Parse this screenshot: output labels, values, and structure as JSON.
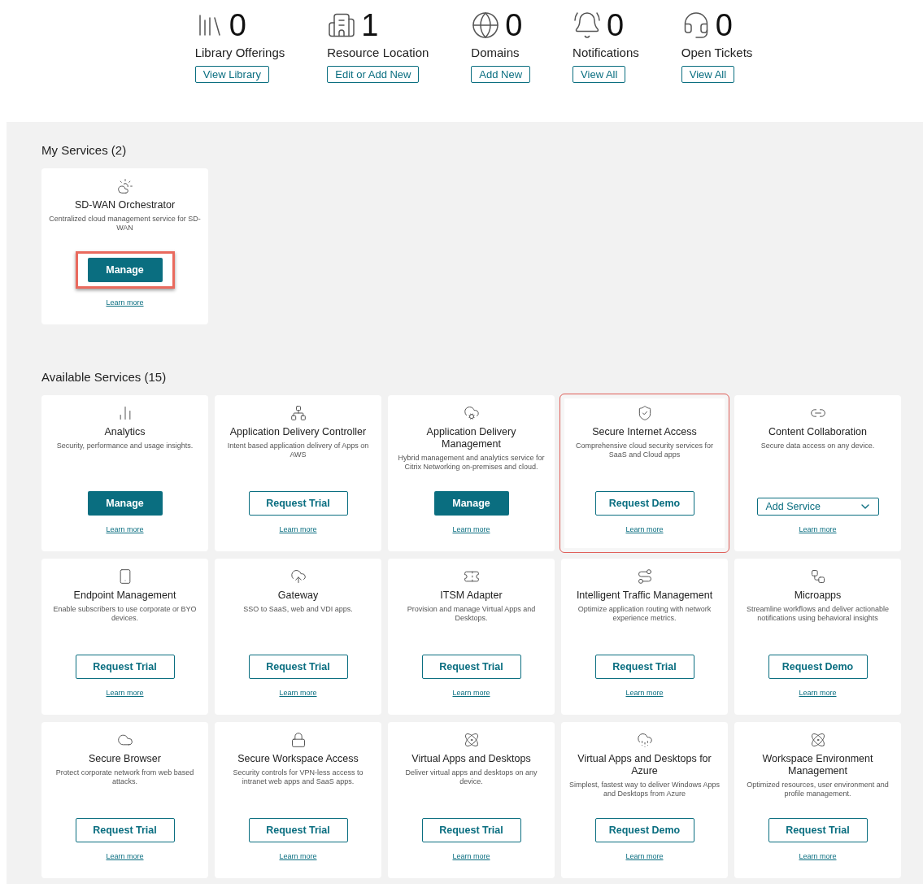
{
  "stats": [
    {
      "count": "0",
      "label": "Library Offerings",
      "action": "View Library"
    },
    {
      "count": "1",
      "label": "Resource Location",
      "action": "Edit or Add New"
    },
    {
      "count": "0",
      "label": "Domains",
      "action": "Add New"
    },
    {
      "count": "0",
      "label": "Notifications",
      "action": "View All"
    },
    {
      "count": "0",
      "label": "Open Tickets",
      "action": "View All"
    }
  ],
  "my_services": {
    "title": "My Services (2)",
    "cards": [
      {
        "title": "SD-WAN Orchestrator",
        "description": "Centralized cloud management service for SD-WAN",
        "button": {
          "kind": "primary",
          "label": "Manage"
        },
        "link": "Learn more",
        "highlighted": true
      }
    ]
  },
  "available_services": {
    "title": "Available Services (15)",
    "cards": [
      {
        "title": "Analytics",
        "description": "Security, performance and usage insights.",
        "button": {
          "kind": "primary",
          "label": "Manage"
        },
        "link": "Learn more",
        "highlighted": false
      },
      {
        "title": "Application Delivery Controller",
        "description": "Intent based application delivery of Apps on AWS",
        "button": {
          "kind": "outline",
          "label": "Request Trial"
        },
        "link": "Learn more",
        "highlighted": false
      },
      {
        "title": "Application Delivery Management",
        "description": "Hybrid management and analytics service for Citrix Networking on-premises and cloud.",
        "button": {
          "kind": "primary",
          "label": "Manage"
        },
        "link": "Learn more",
        "highlighted": false
      },
      {
        "title": "Secure Internet Access",
        "description": "Comprehensive cloud security services for SaaS and Cloud apps",
        "button": {
          "kind": "outline",
          "label": "Request Demo"
        },
        "link": "Learn more",
        "highlighted": true
      },
      {
        "title": "Content Collaboration",
        "description": "Secure data access on any device.",
        "button": {
          "kind": "dropdown",
          "label": "Add Service"
        },
        "link": "Learn more",
        "highlighted": false
      },
      {
        "title": "Endpoint Management",
        "description": "Enable subscribers to use corporate or BYO devices.",
        "button": {
          "kind": "outline",
          "label": "Request Trial"
        },
        "link": "Learn more",
        "highlighted": false
      },
      {
        "title": "Gateway",
        "description": "SSO to SaaS, web and VDI apps.",
        "button": {
          "kind": "outline",
          "label": "Request Trial"
        },
        "link": "Learn more",
        "highlighted": false
      },
      {
        "title": "ITSM Adapter",
        "description": "Provision and manage Virtual Apps and Desktops.",
        "button": {
          "kind": "outline",
          "label": "Request Trial"
        },
        "link": "Learn more",
        "highlighted": false
      },
      {
        "title": "Intelligent Traffic Management",
        "description": "Optimize application routing with network experience metrics.",
        "button": {
          "kind": "outline",
          "label": "Request Trial"
        },
        "link": "Learn more",
        "highlighted": false
      },
      {
        "title": "Microapps",
        "description": "Streamline workflows and deliver actionable notifications using behavioral insights",
        "button": {
          "kind": "outline",
          "label": "Request Demo"
        },
        "link": "Learn more",
        "highlighted": false
      },
      {
        "title": "Secure Browser",
        "description": "Protect corporate network from web based attacks.",
        "button": {
          "kind": "outline",
          "label": "Request Trial"
        },
        "link": "Learn more",
        "highlighted": false
      },
      {
        "title": "Secure Workspace Access",
        "description": "Security controls for VPN-less access to intranet web apps and SaaS apps.",
        "button": {
          "kind": "outline",
          "label": "Request Trial"
        },
        "link": "Learn more",
        "highlighted": false
      },
      {
        "title": "Virtual Apps and Desktops",
        "description": "Deliver virtual apps and desktops on any device.",
        "button": {
          "kind": "outline",
          "label": "Request Trial"
        },
        "link": "Learn more",
        "highlighted": false
      },
      {
        "title": "Virtual Apps and Desktops for Azure",
        "description": "Simplest, fastest way to deliver Windows Apps and Desktops from Azure",
        "button": {
          "kind": "outline",
          "label": "Request Demo"
        },
        "link": "Learn more",
        "highlighted": false
      },
      {
        "title": "Workspace Environment Management",
        "description": "Optimized resources, user environment and profile management.",
        "button": {
          "kind": "outline",
          "label": "Request Trial"
        },
        "link": "Learn more",
        "highlighted": false
      }
    ]
  }
}
